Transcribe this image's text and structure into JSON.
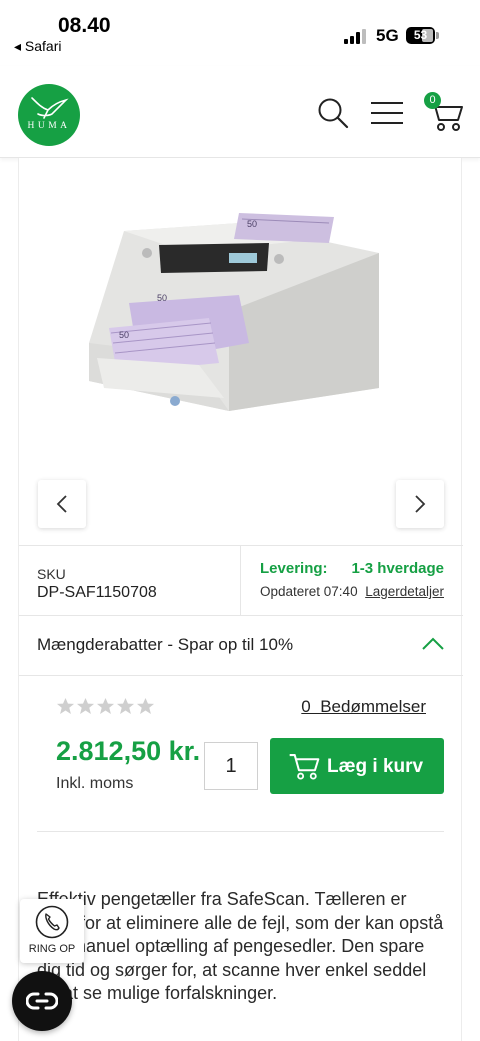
{
  "status_bar": {
    "time": "08.40",
    "back_app": "◂ Safari",
    "network": "5G",
    "battery": "53"
  },
  "header": {
    "logo_text": "HUMA",
    "cart_count": "0"
  },
  "product": {
    "sku_label": "SKU",
    "sku": "DP-SAF1150708",
    "delivery_label": "Levering:",
    "delivery_value": "1-3 hverdage",
    "updated": "Opdateret 07:40",
    "stock_link": "Lagerdetaljer",
    "discount": "Mængderabatter - Spar op til 10%",
    "rating": 0,
    "ratings_link": "0  Bedømmelser",
    "price": "2.812,50 kr.",
    "vat": "Inkl. moms",
    "quantity": "1",
    "add_to_cart": "Læg i kurv",
    "description": "Effektiv pengetæller fra SafeScan. Tælleren er lavet for at eliminere alle de fejl, som der kan opstå ved manuel optælling af pengesedler. Den spare dig tid og sørger for, at scanne hver enkel seddel for at se mulige forfalskninger.",
    "note_labels": [
      "50",
      "50",
      "50"
    ]
  },
  "call_widget": {
    "label": "RING OP"
  },
  "colors": {
    "brand_green": "#16a044",
    "star_grey": "#cfcfcf"
  },
  "icons": [
    "search-icon",
    "menu-icon",
    "cart-icon",
    "chevron-left-icon",
    "chevron-right-icon",
    "chevron-up-icon",
    "star-icon",
    "phone-icon",
    "chat-icon"
  ]
}
